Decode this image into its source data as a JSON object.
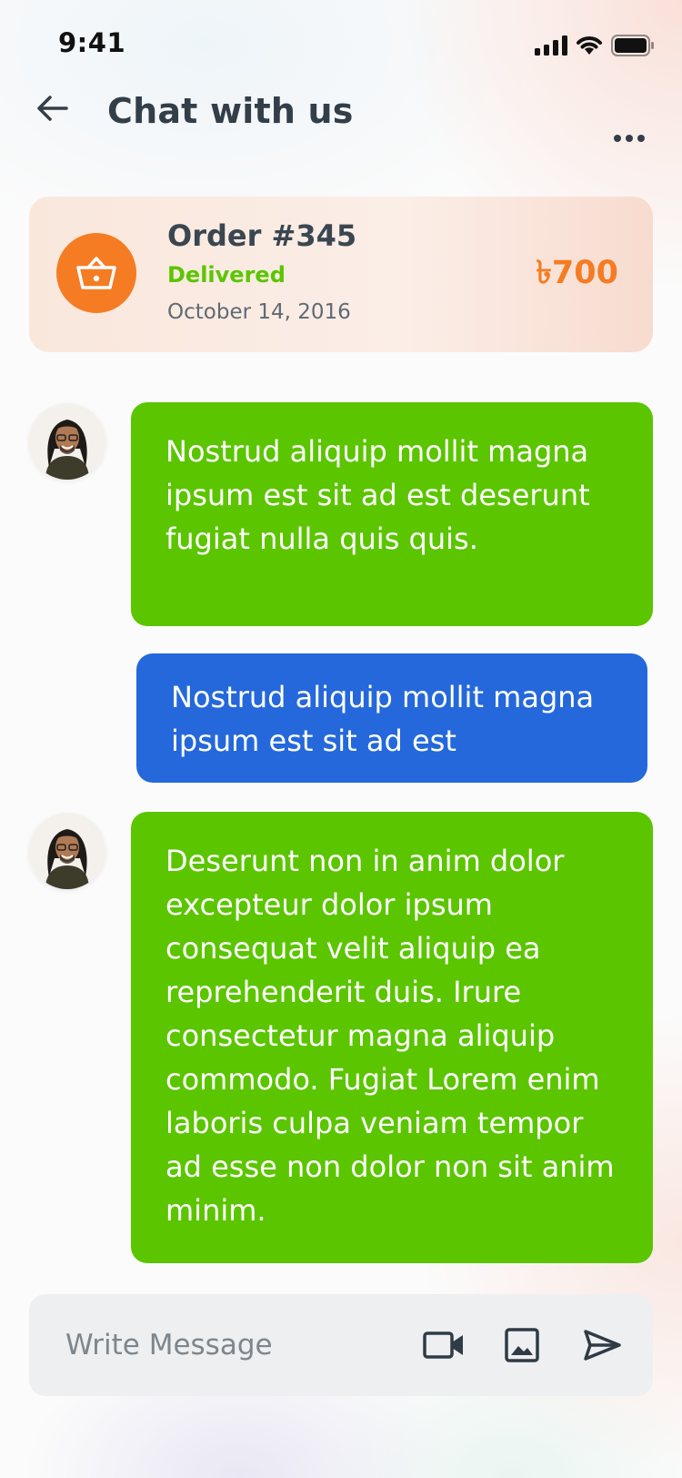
{
  "status_bar": {
    "time": "9:41"
  },
  "header": {
    "title": "Chat with us"
  },
  "order": {
    "title": "Order #345",
    "status": "Delivered",
    "date": "October 14, 2016",
    "price": "৳700"
  },
  "messages": [
    {
      "sender": "agent",
      "text": "Nostrud aliquip mollit magna ipsum est sit ad est deserunt fugiat nulla quis quis."
    },
    {
      "sender": "user",
      "text": "Nostrud aliquip mollit magna ipsum est sit ad est"
    },
    {
      "sender": "agent",
      "text": "Deserunt non in anim dolor excepteur dolor ipsum consequat velit aliquip ea reprehenderit duis. Irure consectetur magna aliquip commodo. Fugiat Lorem enim laboris culpa veniam tempor ad esse non dolor non sit anim minim."
    }
  ],
  "composer": {
    "placeholder": "Write Message"
  },
  "icons": {
    "back": "arrow-left-icon",
    "more": "more-horizontal-icon",
    "basket": "basket-icon",
    "video": "video-camera-icon",
    "image": "image-icon",
    "send": "send-icon"
  },
  "colors": {
    "agent_bubble": "#5BC500",
    "user_bubble": "#2468DB",
    "accent": "#F57C23",
    "status_delivered": "#5BC500",
    "text_dark": "#323E48"
  }
}
